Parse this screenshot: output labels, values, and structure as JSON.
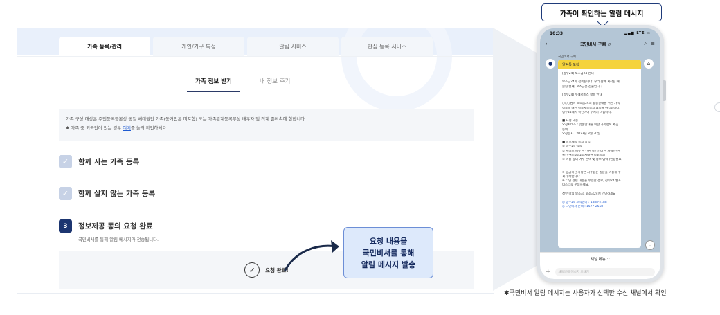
{
  "web": {
    "tabs": [
      {
        "label": "가족 등록/관리",
        "active": true
      },
      {
        "label": "개인/가구 특성",
        "active": false
      },
      {
        "label": "알림 서비스",
        "active": false
      },
      {
        "label": "관심 등록 서비스",
        "active": false
      }
    ],
    "subtabs": [
      {
        "label": "가족 정보 받기",
        "active": true
      },
      {
        "label": "내 정보 주기",
        "active": false
      }
    ],
    "notice": {
      "line1": "가족 구성 대상은 주민등록등본상 동일 세대원인 가족(동거인은 미포함) 또는 가족관계등록부상 배우자 및 직계 존비속에 한합니다.",
      "line2_prefix": "✱ 가족 중 외국인이 있는 경우 ",
      "line2_link": "여기",
      "line2_suffix": "를 눌러 확인하세요."
    },
    "steps": [
      {
        "label": "함께 사는 가족 등록",
        "status": "done"
      },
      {
        "label": "함께 살지 않는 가족  등록",
        "status": "done"
      },
      {
        "number": "3",
        "label": "정보제공 동의 요청 완료",
        "status": "current"
      }
    ],
    "step_desc": "국민비서를 통해 알림 메시지가 전송됩니다.",
    "done_label": "요청 완료!"
  },
  "callout": {
    "lines": [
      "요청 내용을",
      "국민비서를 통해",
      "알림 메시지 발송"
    ]
  },
  "phone": {
    "title": "가족이 확인하는 알림 메시지",
    "time": "10:33",
    "signal": "LTE",
    "chat_title": "국민비서 구삐 ◎",
    "sender": "국민비서 구삐",
    "bubble_header": "알림톡 도착",
    "message": [
      "[정부24] 보조금24 안내",
      "",
      "보조금24가 접속됩니다. 우리 삶에 시작된 때",
      "문된 번째, 보조금은 선물입니다.",
      "",
      "[정부24] 수혜서비스 활용 안내",
      "",
      "○○○님이 보조금24의 활용안내를 위한 가족",
      "정보에 대한 정보제공동의 요청을 하였습니다.",
      "정부24에서 확인하여 주시기 바랍니다.",
      "",
      "■ 요청 내용",
      "요청서비스 : 맞춤안내를 위한 가족정보 제공",
      "동의",
      "요청일자 : 2023년 8월 30일",
      "",
      "■ 정보제공 동의 방법",
      "① 정부24 접속",
      "② 서비스 메뉴 → 간편 확인안내 → 사실/민원",
      "확인 →보조금24 세대원 정보동의",
      "③ 이용 동의 여부 선택 및 정보 입력 (인증필요)",
      "",
      "",
      "※ 궁금하신 사항은 자주묻는 질문을 이용해 주",
      "시기 바랍니다.",
      "※ 타인 관련 내용을 수신한 경우, 정부24 헬프",
      "데스크로 문의하세요.",
      "",
      "정부 나의 보조금, 보조금24에 안녕하세요",
      "",
      "◎ 정부24 고객센터 : 1588-2188",
      "◎ 국민비서 문의 : 1577-2558"
    ],
    "menu_label": "채널 메뉴 ^",
    "input_placeholder": "채팅방에 메시지 보내기"
  },
  "footnote": "✱국민비서 알림 메시지는 사용자가 선택한 수신 채널에서 확인",
  "colors": {
    "primary_navy": "#1c3570",
    "callout_bg": "#dde9fb",
    "kakao_yellow": "#f5d33b",
    "link_blue": "#1f5bd1"
  }
}
